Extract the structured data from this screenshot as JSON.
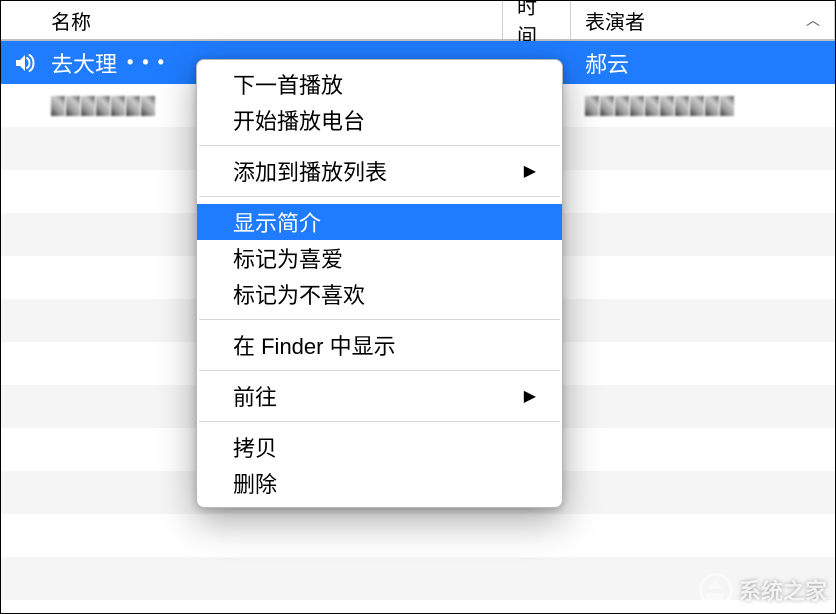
{
  "header": {
    "name_label": "名称",
    "time_label": "时间",
    "artist_label": "表演者"
  },
  "rows": {
    "selected": {
      "title": "去大理",
      "ellipsis": "• • •",
      "artist": "郝云"
    }
  },
  "menu": {
    "play_next": "下一首播放",
    "start_radio": "开始播放电台",
    "add_to_playlist": "添加到播放列表",
    "get_info": "显示简介",
    "mark_loved": "标记为喜爱",
    "mark_disliked": "标记为不喜欢",
    "show_in_finder": "在 Finder 中显示",
    "go_to": "前往",
    "copy": "拷贝",
    "delete": "删除"
  },
  "watermark": {
    "text": "系统之家"
  }
}
